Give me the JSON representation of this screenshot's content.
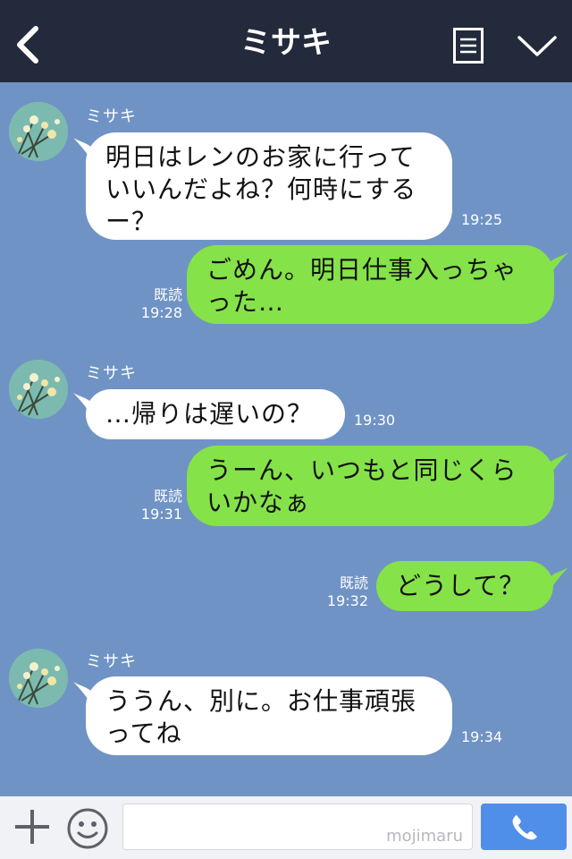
{
  "header": {
    "title": "ミサキ",
    "back_icon": "chevron-left-icon",
    "menu_icon": "note-menu-icon",
    "dropdown_icon": "chevron-down-icon"
  },
  "messages": [
    {
      "id": "m1",
      "sender": "ミサキ",
      "direction": "in",
      "lines": [
        "明日はレンのお家に行って",
        "いいんだよね？何時にする",
        "ー？"
      ],
      "time": "19:25"
    },
    {
      "id": "m2",
      "direction": "out",
      "lines": [
        "ごめん。明日仕事入っちゃ",
        "った…"
      ],
      "read": "既読",
      "time": "19:28"
    },
    {
      "id": "m3",
      "sender": "ミサキ",
      "direction": "in",
      "lines": [
        "…帰りは遅いの？"
      ],
      "time": "19:30"
    },
    {
      "id": "m4",
      "direction": "out",
      "lines": [
        "うーん、いつもと同じくら",
        "いかなぁ"
      ],
      "read": "既読",
      "time": "19:31"
    },
    {
      "id": "m5",
      "direction": "out",
      "lines": [
        "どうして？"
      ],
      "read": "既読",
      "time": "19:32"
    },
    {
      "id": "m6",
      "sender": "ミサキ",
      "direction": "in",
      "lines": [
        "ううん、別に。お仕事頑張",
        "ってね"
      ],
      "time": "19:34"
    }
  ],
  "footer": {
    "plus_icon": "plus-icon",
    "emoji_icon": "smiley-icon",
    "input_value": "",
    "watermark": "mojimaru",
    "send_icon": "phone-icon"
  },
  "colors": {
    "header_bg": "#232a3b",
    "chat_bg": "#7093c5",
    "in_bubble": "#ffffff",
    "out_bubble": "#85e249",
    "send_button": "#4f8fea"
  }
}
